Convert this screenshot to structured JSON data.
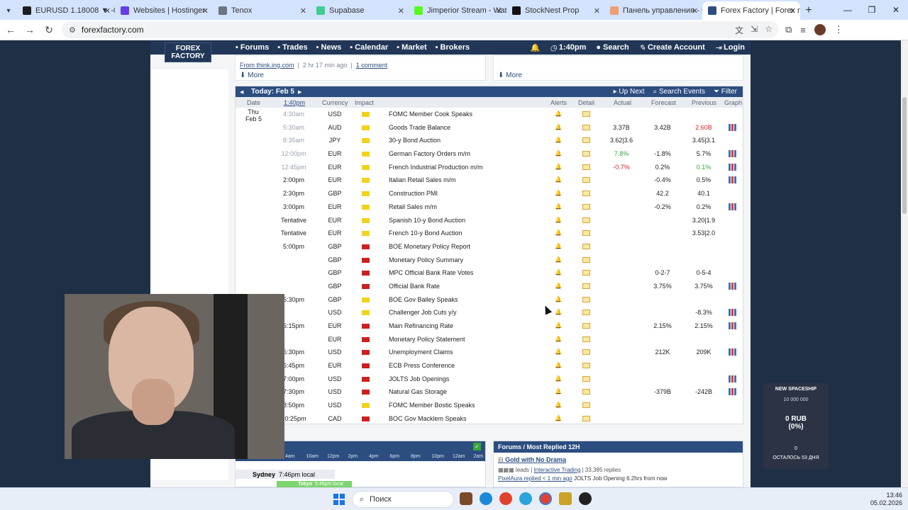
{
  "browser": {
    "tabs": [
      {
        "title": "EURUSD 1.18008 ▼ -0.0",
        "color": "#1e1e1e"
      },
      {
        "title": "Websites | Hostinger",
        "color": "#673de6"
      },
      {
        "title": "Tenox",
        "color": "#6d7580"
      },
      {
        "title": "Supabase",
        "color": "#3ecf8e"
      },
      {
        "title": "Jimperior Stream - Watc",
        "color": "#53fc18"
      },
      {
        "title": "StockNest Prop",
        "color": "#111111"
      },
      {
        "title": "Панель управления - De",
        "color": "#f0a070"
      },
      {
        "title": "Forex Factory | Forex ma",
        "color": "#2c4d80"
      }
    ],
    "url": "forexfactory.com"
  },
  "nav": {
    "logo": "FOREX FACTORY",
    "menu": [
      "Forums",
      "Trades",
      "News",
      "Calendar",
      "Market",
      "Brokers"
    ],
    "time": "1:40pm",
    "search": "Search",
    "create_account": "Create Account",
    "login": "Login"
  },
  "news": {
    "source_line": "From think.ing.com",
    "age": "2 hr 17 min ago",
    "comments": "1 comment",
    "more": "More"
  },
  "calendar": {
    "day_label": "Today: Feb 5",
    "up_next": "Up Next",
    "search_events": "Search Events",
    "filter": "Filter",
    "columns": {
      "date": "Date",
      "time": "1:40pm",
      "currency": "Currency",
      "impact": "Impact",
      "alerts": "Alerts",
      "detail": "Detail",
      "actual": "Actual",
      "forecast": "Forecast",
      "previous": "Previous",
      "graph": "Graph"
    },
    "date_day": "Thu",
    "date_date": "Feb 5",
    "rows": [
      {
        "time": "4:30am",
        "cur": "USD",
        "impact": "yellow",
        "event": "FOMC Member Cook Speaks",
        "actual": "",
        "forecast": "",
        "previous": "",
        "graph": false,
        "past": true
      },
      {
        "time": "5:30am",
        "cur": "AUD",
        "impact": "yellow",
        "event": "Goods Trade Balance",
        "actual": "3.37B",
        "forecast": "3.42B",
        "previous": "2.60B",
        "prev_color": "red",
        "graph": true,
        "past": true
      },
      {
        "time": "8:35am",
        "cur": "JPY",
        "impact": "yellow",
        "event": "30-y Bond Auction",
        "actual": "3.62|3.6",
        "forecast": "",
        "previous": "3.45|3.1",
        "graph": false,
        "past": true
      },
      {
        "time": "12:00pm",
        "cur": "EUR",
        "impact": "yellow",
        "event": "German Factory Orders m/m",
        "actual": "7.8%",
        "actual_color": "green",
        "forecast": "-1.8%",
        "previous": "5.7%",
        "graph": true,
        "past": true
      },
      {
        "time": "12:45pm",
        "cur": "EUR",
        "impact": "yellow",
        "event": "French Industrial Production m/m",
        "actual": "-0.7%",
        "actual_color": "red",
        "forecast": "0.2%",
        "previous": "0.1%",
        "prev_color": "green",
        "graph": true,
        "past": true
      },
      {
        "time": "2:00pm",
        "cur": "EUR",
        "impact": "yellow",
        "event": "Italian Retail Sales m/m",
        "actual": "",
        "forecast": "-0.4%",
        "previous": "0.5%",
        "graph": true,
        "past": false
      },
      {
        "time": "2:30pm",
        "cur": "GBP",
        "impact": "yellow",
        "event": "Construction PMI",
        "actual": "",
        "forecast": "42.2",
        "previous": "40.1",
        "graph": false,
        "past": false
      },
      {
        "time": "3:00pm",
        "cur": "EUR",
        "impact": "yellow",
        "event": "Retail Sales m/m",
        "actual": "",
        "forecast": "-0.2%",
        "previous": "0.2%",
        "graph": true,
        "past": false
      },
      {
        "time": "Tentative",
        "cur": "EUR",
        "impact": "yellow",
        "event": "Spanish 10-y Bond Auction",
        "actual": "",
        "forecast": "",
        "previous": "3.20|1.9",
        "graph": false,
        "past": false
      },
      {
        "time": "Tentative",
        "cur": "EUR",
        "impact": "yellow",
        "event": "French 10-y Bond Auction",
        "actual": "",
        "forecast": "",
        "previous": "3.53|2.0",
        "graph": false,
        "past": false
      },
      {
        "time": "5:00pm",
        "cur": "GBP",
        "impact": "red",
        "event": "BOE Monetary Policy Report",
        "actual": "",
        "forecast": "",
        "previous": "",
        "graph": false,
        "past": false
      },
      {
        "time": "",
        "cur": "GBP",
        "impact": "red",
        "event": "Monetary Policy Summary",
        "actual": "",
        "forecast": "",
        "previous": "",
        "graph": false,
        "past": false
      },
      {
        "time": "",
        "cur": "GBP",
        "impact": "red",
        "event": "MPC Official Bank Rate Votes",
        "actual": "",
        "forecast": "0-2-7",
        "previous": "0-5-4",
        "graph": false,
        "past": false
      },
      {
        "time": "",
        "cur": "GBP",
        "impact": "red",
        "event": "Official Bank Rate",
        "actual": "",
        "forecast": "3.75%",
        "previous": "3.75%",
        "graph": true,
        "past": false
      },
      {
        "time": "5:30pm",
        "cur": "GBP",
        "impact": "yellow",
        "event": "BOE Gov Bailey Speaks",
        "actual": "",
        "forecast": "",
        "previous": "",
        "graph": false,
        "past": false
      },
      {
        "time": "",
        "cur": "USD",
        "impact": "yellow",
        "event": "Challenger Job Cuts y/y",
        "actual": "",
        "forecast": "",
        "previous": "-8.3%",
        "graph": true,
        "past": false
      },
      {
        "time": "6:15pm",
        "cur": "EUR",
        "impact": "red",
        "event": "Main Refinancing Rate",
        "actual": "",
        "forecast": "2.15%",
        "previous": "2.15%",
        "graph": true,
        "past": false
      },
      {
        "time": "",
        "cur": "EUR",
        "impact": "red",
        "event": "Monetary Policy Statement",
        "actual": "",
        "forecast": "",
        "previous": "",
        "graph": false,
        "past": false
      },
      {
        "time": "6:30pm",
        "cur": "USD",
        "impact": "red",
        "event": "Unemployment Claims",
        "actual": "",
        "forecast": "212K",
        "previous": "209K",
        "graph": true,
        "past": false
      },
      {
        "time": "6:45pm",
        "cur": "EUR",
        "impact": "red",
        "event": "ECB Press Conference",
        "actual": "",
        "forecast": "",
        "previous": "",
        "graph": false,
        "past": false
      },
      {
        "time": "7:00pm",
        "cur": "USD",
        "impact": "red",
        "event": "JOLTS Job Openings",
        "actual": "",
        "forecast": "",
        "previous": "",
        "graph": true,
        "past": false
      },
      {
        "time": "7:30pm",
        "cur": "USD",
        "impact": "red",
        "event": "Natural Gas Storage",
        "actual": "",
        "forecast": "-379B",
        "previous": "-242B",
        "graph": true,
        "past": false
      },
      {
        "time": "8:50pm",
        "cur": "USD",
        "impact": "yellow",
        "event": "FOMC Member Bostic Speaks",
        "actual": "",
        "forecast": "",
        "previous": "",
        "graph": false,
        "past": false
      },
      {
        "time": "10:25pm",
        "cur": "CAD",
        "impact": "red",
        "event": "BOC Gov Macklem Speaks",
        "actual": "",
        "forecast": "",
        "previous": "",
        "graph": false,
        "past": false
      }
    ]
  },
  "sessions": {
    "times": [
      "4am",
      "10am",
      "12pm",
      "2pm",
      "4pm",
      "6pm",
      "8pm",
      "10pm",
      "12am",
      "2am"
    ],
    "sydney": "Sydney",
    "sydney_time": "7:46pm local",
    "tokyo": "Tokyo",
    "tokyo_time": "5:46pm local"
  },
  "forum": {
    "header": "Forums / Most Replied 12H",
    "thread": "Gold with No Drama",
    "leads": "leads",
    "category": "Interactive Trading",
    "replies": "33,385 replies",
    "last_reply": "PixelAura replied < 1 min ago",
    "last_snippet": "JOLTS Job Opening 6.2hrs from now"
  },
  "spaceship": {
    "title": "NEW SPACESHIP",
    "target": "10 000 000",
    "amount": "0 RUB",
    "percent": "(0%)",
    "count": "0",
    "remaining": "ОСТАЛОСЬ 53 ДНЯ"
  },
  "taskbar": {
    "search": "Поиск",
    "time": "13:46",
    "date": "05.02.2026"
  },
  "colors": {
    "impact_yellow": "#f2d21b",
    "impact_red": "#cc1f1f",
    "navy": "#223757",
    "blue": "#2c4d80"
  }
}
